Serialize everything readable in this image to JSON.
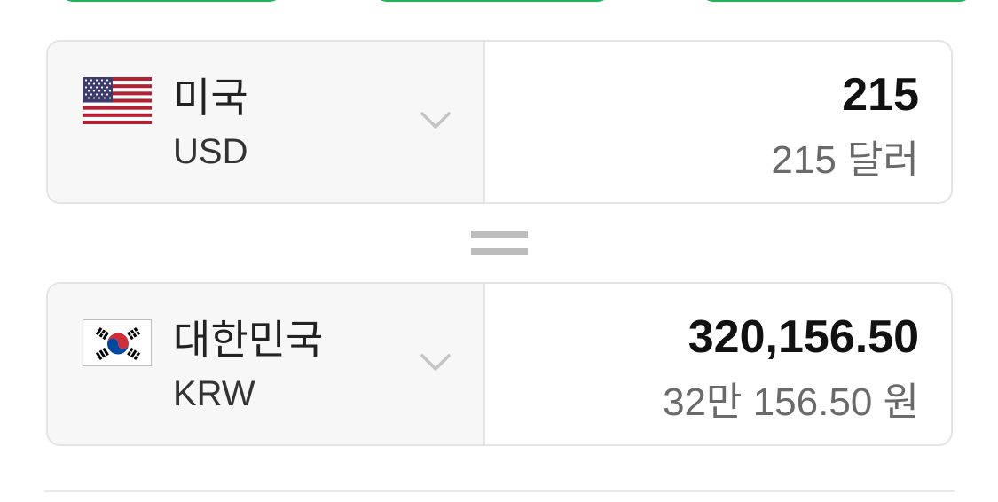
{
  "colors": {
    "accent_green": "#1fb35a",
    "border": "#e4e4e4",
    "selector_bg": "#f7f7f7",
    "amount": "#111111",
    "amount_text": "#6a6a6a"
  },
  "converter": {
    "from": {
      "flag_icon": "us-flag-icon",
      "country": "미국",
      "code": "USD",
      "amount": "215",
      "amount_text": "215 달러"
    },
    "equals_icon": "equals-icon",
    "to": {
      "flag_icon": "kr-flag-icon",
      "country": "대한민국",
      "code": "KRW",
      "amount": "320,156.50",
      "amount_text": "32만 156.50 원"
    }
  }
}
